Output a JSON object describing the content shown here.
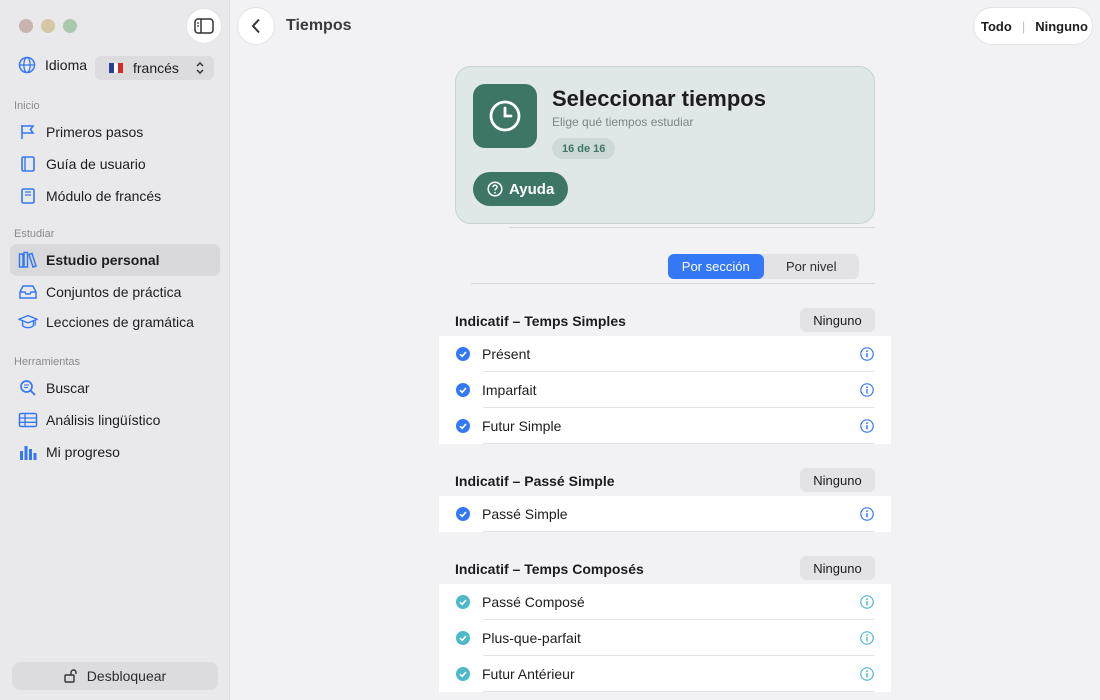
{
  "sidebar": {
    "language_label": "Idioma",
    "language_value": "francés",
    "sections": [
      {
        "title": "Inicio",
        "items": [
          {
            "label": "Primeros pasos",
            "icon": "flag-icon"
          },
          {
            "label": "Guía de usuario",
            "icon": "book-icon"
          },
          {
            "label": "Módulo de francés",
            "icon": "module-book-icon"
          }
        ]
      },
      {
        "title": "Estudiar",
        "items": [
          {
            "label": "Estudio personal",
            "icon": "books-icon",
            "active": true
          },
          {
            "label": "Conjuntos de práctica",
            "icon": "tray-icon"
          },
          {
            "label": "Lecciones de gramática",
            "icon": "graduation-cap-icon"
          }
        ]
      },
      {
        "title": "Herramientas",
        "items": [
          {
            "label": "Buscar",
            "icon": "search-icon"
          },
          {
            "label": "Análisis lingüístico",
            "icon": "table-icon"
          },
          {
            "label": "Mi progreso",
            "icon": "bar-chart-icon"
          }
        ]
      }
    ],
    "unlock_label": "Desbloquear"
  },
  "header": {
    "title": "Tiempos",
    "all_label": "Todo",
    "none_label": "Ninguno"
  },
  "card": {
    "title": "Seleccionar tiempos",
    "subtitle": "Elige qué tiempos estudiar",
    "badge": "16 de 16",
    "help_label": "Ayuda"
  },
  "segments": [
    "Por sección",
    "Por nivel"
  ],
  "groups": [
    {
      "title": "Indicatif – Temps Simples",
      "none_label": "Ninguno",
      "items": [
        "Présent",
        "Imparfait",
        "Futur Simple"
      ],
      "check_color": "#3478f6"
    },
    {
      "title": "Indicatif – Passé Simple",
      "none_label": "Ninguno",
      "items": [
        "Passé Simple"
      ],
      "check_color": "#3478f6"
    },
    {
      "title": "Indicatif – Temps Composés",
      "none_label": "Ninguno",
      "items": [
        "Passé Composé",
        "Plus-que-parfait",
        "Futur Antérieur"
      ],
      "check_color": "#4fb9c9"
    }
  ],
  "colors": {
    "accent": "#3478f6",
    "green": "#3d7566",
    "teal_check": "#4fb9c9"
  }
}
